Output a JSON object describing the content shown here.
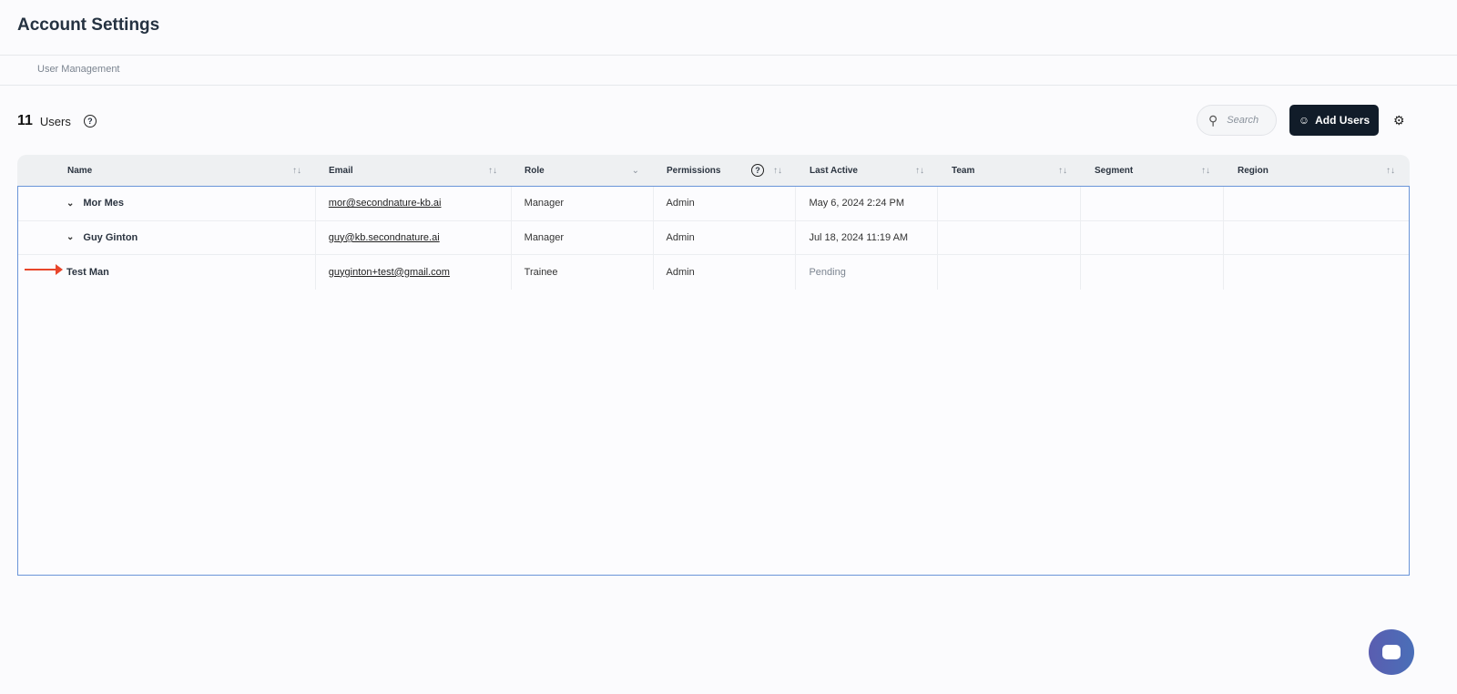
{
  "header": {
    "title": "Account Settings",
    "breadcrumb": "User Management"
  },
  "toolbar": {
    "count": "11",
    "count_label": "Users",
    "search_placeholder": "Search",
    "add_label": "Add Users"
  },
  "table": {
    "columns": [
      "Name",
      "Email",
      "Role",
      "Permissions",
      "Last Active",
      "Team",
      "Segment",
      "Region"
    ],
    "rows": [
      {
        "name": "Mor Mes",
        "email": "mor@secondnature-kb.ai",
        "role": "Manager",
        "permissions": "Admin",
        "last_active": "May 6, 2024 2:24 PM",
        "team": "",
        "segment": "",
        "region": ""
      },
      {
        "name": "Guy Ginton",
        "email": "guy@kb.secondnature.ai",
        "role": "Manager",
        "permissions": "Admin",
        "last_active": "Jul 18, 2024 11:19 AM",
        "team": "",
        "segment": "",
        "region": ""
      },
      {
        "name": "Test Man",
        "email": "guyginton+test@gmail.com",
        "role": "Trainee",
        "permissions": "Admin",
        "last_active": "Pending",
        "team": "",
        "segment": "",
        "region": ""
      }
    ]
  },
  "colors": {
    "accent": "#111c29",
    "arrow": "#e8462b",
    "chat": "#5a5db0"
  }
}
